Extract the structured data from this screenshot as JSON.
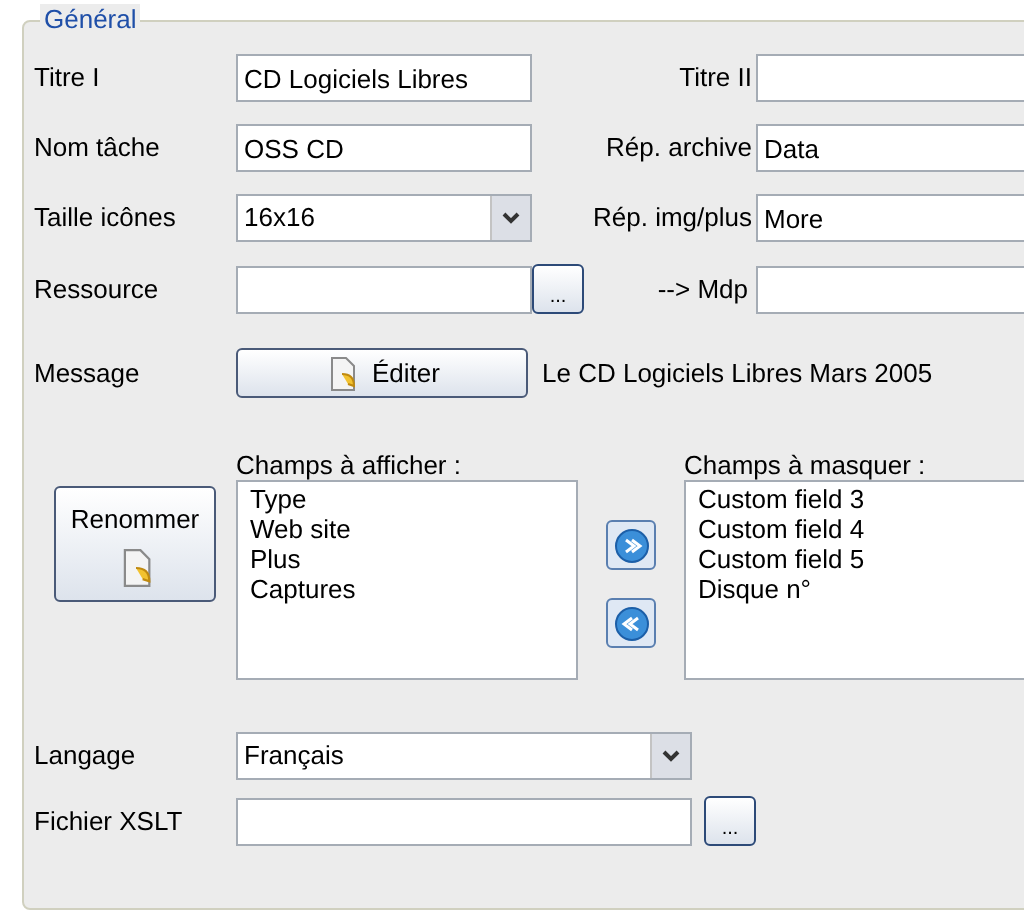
{
  "group": {
    "title": "Général"
  },
  "fields": [
    {
      "label": "Titre I",
      "value": "CD Logiciels Libres",
      "right_label": "Titre II"
    },
    {
      "label": "Nom tâche",
      "value": "OSS CD",
      "right_label": "Rép. archive",
      "right_value": "Data"
    },
    {
      "label": "Taille icônes",
      "kind": "combo",
      "value": "16x16",
      "right_label": "Rép. img/plus",
      "right_value": "More"
    },
    {
      "label": "Ressource",
      "kind": "browse",
      "browse": "...",
      "right_label": "--> Mdp"
    }
  ],
  "message": {
    "label": "Message",
    "button": "Éditer",
    "text": "Le CD Logiciels Libres Mars 2005"
  },
  "rename_button": "Renommer",
  "shown_fields": {
    "title": "Champs à afficher :",
    "items": [
      "Type",
      "Web site",
      "Plus",
      "Captures"
    ]
  },
  "hidden_fields": {
    "title": "Champs à masquer :",
    "items": [
      "Custom field 3",
      "Custom field 4",
      "Custom field 5",
      "Disque n°"
    ]
  },
  "language": {
    "label": "Langage",
    "value": "Français"
  },
  "xslt": {
    "label": "Fichier XSLT",
    "browse": "..."
  }
}
